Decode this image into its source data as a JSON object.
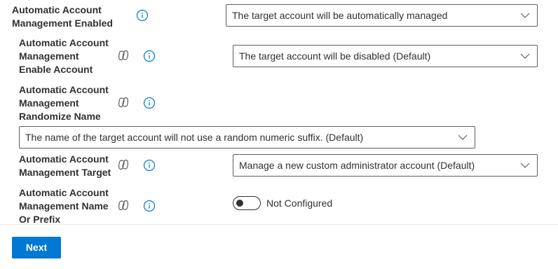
{
  "settings": [
    {
      "label_lines": [
        "Automatic Account",
        "Management Enabled"
      ],
      "value": "The target account will be automatically managed",
      "info_icon": "info-icon",
      "has_copilot_icon": false
    },
    {
      "label_lines": [
        "Automatic Account",
        "Management",
        "Enable Account"
      ],
      "value": "The target account will be disabled (Default)",
      "info_icon": "info-icon",
      "copilot_icon": "copilot-icon"
    },
    {
      "label_lines": [
        "Automatic Account",
        "Management",
        "Randomize Name"
      ],
      "value": "The name of the target account will not use a random numeric suffix. (Default)",
      "info_icon": "info-icon",
      "copilot_icon": "copilot-icon"
    },
    {
      "label_lines": [
        "Automatic Account",
        "Management Target"
      ],
      "value": "Manage a new custom administrator account (Default)",
      "info_icon": "info-icon",
      "copilot_icon": "copilot-icon"
    },
    {
      "label_lines": [
        "Automatic Account",
        "Management Name",
        "Or Prefix"
      ],
      "toggle_state": "off",
      "toggle_label": "Not Configured",
      "info_icon": "info-icon",
      "copilot_icon": "copilot-icon"
    }
  ],
  "footer": {
    "next_label": "Next"
  },
  "colors": {
    "primary": "#0078d4",
    "text": "#323130",
    "border": "#605e5c",
    "info_icon": "#0078d4"
  }
}
